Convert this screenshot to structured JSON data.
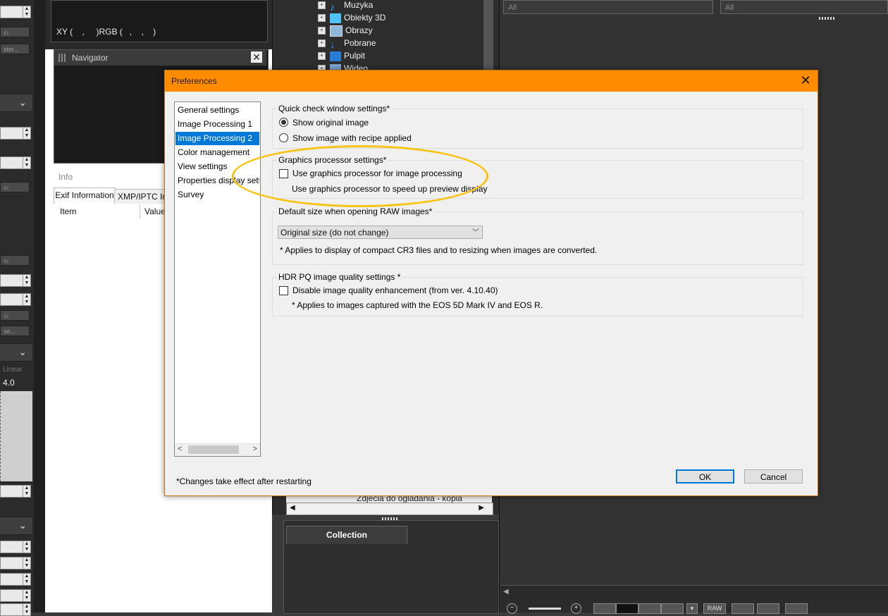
{
  "background": {
    "left_strip": {
      "spin_value": "4.0",
      "button_text_1": "ster...",
      "button_text_2": "se...",
      "linear_label": "Linear"
    },
    "histogram": {
      "readout": "XY (    ,     )RGB (   ,    ,    )"
    },
    "navigator": {
      "title": "Navigator",
      "close": "✕"
    },
    "info": {
      "title": "Info",
      "tabs": [
        "Exif Information",
        "XMP/IPTC Inf"
      ],
      "columns": [
        "Item",
        "Value"
      ]
    },
    "folder_tree": {
      "items": [
        {
          "label": "Muzyka",
          "icon": "music-icon",
          "color": "#3aa0ff"
        },
        {
          "label": "Obiekty 3D",
          "icon": "cube-icon",
          "color": "#4fc3f7"
        },
        {
          "label": "Obrazy",
          "icon": "picture-icon",
          "color": "#8fb7d9"
        },
        {
          "label": "Pobrane",
          "icon": "download-icon",
          "color": "#2f8cff"
        },
        {
          "label": "Pulpit",
          "icon": "desktop-icon",
          "color": "#2a7bd4"
        },
        {
          "label": "Wideo",
          "icon": "video-icon",
          "color": "#7aa7d0"
        }
      ],
      "bottom_item": "Zdjecia do ogladania - kopia"
    },
    "collection": {
      "tab": "Collection"
    },
    "filters": [
      "All",
      "All"
    ],
    "toolbar": {
      "raw_label": "RAW"
    }
  },
  "dialog": {
    "title": "Preferences",
    "close_label": "✕",
    "categories": [
      {
        "label": "General settings",
        "selected": false
      },
      {
        "label": "Image Processing 1",
        "selected": false
      },
      {
        "label": "Image Processing 2",
        "selected": true
      },
      {
        "label": "Color management",
        "selected": false
      },
      {
        "label": "View settings",
        "selected": false
      },
      {
        "label": "Properties display settir",
        "selected": false
      },
      {
        "label": "Survey",
        "selected": false
      }
    ],
    "quick_check": {
      "label": "Quick check window settings*",
      "options": [
        {
          "label": "Show original image",
          "selected": true
        },
        {
          "label": "Show image with recipe applied",
          "selected": false
        }
      ]
    },
    "graphics": {
      "label": "Graphics processor settings*",
      "checkbox_label": "Use graphics processor for image processing",
      "checked": false,
      "description": "Use graphics processor to speed up preview display"
    },
    "raw_size": {
      "label": "Default size when opening RAW images*",
      "selected": "Original size (do not change)",
      "note": "* Applies to display of compact CR3 files and to resizing when images are converted."
    },
    "hdr": {
      "label": "HDR PQ image quality settings *",
      "checkbox_label": "Disable image quality enhancement (from ver. 4.10.40)",
      "checked": false,
      "note": "* Applies to images captured with the EOS 5D Mark IV and EOS R."
    },
    "footer_note": "*Changes take effect after restarting",
    "ok_label": "OK",
    "cancel_label": "Cancel"
  },
  "colors": {
    "titlebar": "#ff8c00",
    "selection": "#0078d7",
    "highlight_ring": "#f7c415"
  }
}
